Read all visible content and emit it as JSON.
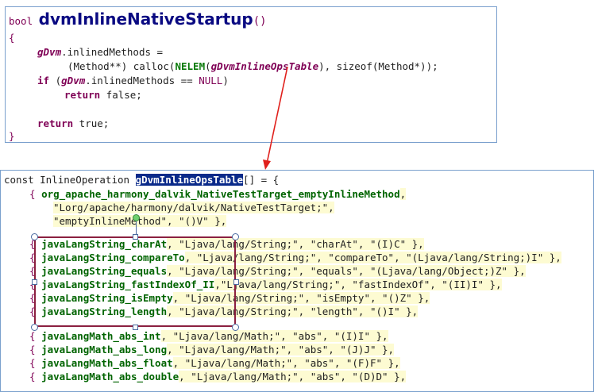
{
  "top": {
    "l1_type": "bool ",
    "l1_name": "dvmInlineNativeStartup",
    "l1_paren": "()",
    "l2": "{",
    "l3_var": "gDvm",
    "l3_rest": ".inlinedMethods =",
    "l4_a": "(Method**) calloc(",
    "l4_macro": "NELEM",
    "l4_b": "(",
    "l4_var": "gDvmInlineOpsTable",
    "l4_c": "), sizeof(Method*));",
    "l5_if": "if",
    "l5_a": " (",
    "l5_var": "gDvm",
    "l5_b": ".inlinedMethods == ",
    "l5_null": "NULL",
    "l5_c": ")",
    "l6_ret": "return",
    "l6_val": " false;",
    "l8_ret": "return",
    "l8_val": " true;",
    "l9": "}"
  },
  "bottom": {
    "decl_a": "const InlineOperation ",
    "decl_hl": "gDvmInlineOpsTable",
    "decl_b": "[] = {",
    "rows": [
      {
        "open": "{ ",
        "fn": "org_apache_harmony_dalvik_NativeTestTarget_emptyInlineMethod",
        "rest": ","
      },
      {
        "open": "",
        "fn": "",
        "rest": "\"Lorg/apache/harmony/dalvik/NativeTestTarget;\","
      },
      {
        "open": "",
        "fn": "",
        "rest": "\"emptyInlineMethod\", \"()V\" },"
      },
      {
        "open": "{ ",
        "fn": "javaLangString_charAt",
        "rest": ", \"Ljava/lang/String;\", \"charAt\", \"(I)C\" },"
      },
      {
        "open": "{ ",
        "fn": "javaLangString_compareTo",
        "rest": ", \"Ljava/lang/String;\", \"compareTo\", \"(Ljava/lang/String;)I\" },"
      },
      {
        "open": "{ ",
        "fn": "javaLangString_equals",
        "rest": ", \"Ljava/lang/String;\", \"equals\", \"(Ljava/lang/Object;)Z\" },"
      },
      {
        "open": "{ ",
        "fn": "javaLangString_fastIndexOf_II",
        "rest": ",\"Ljava/lang/String;\", \"fastIndexOf\", \"(II)I\" },"
      },
      {
        "open": "{ ",
        "fn": "javaLangString_isEmpty",
        "rest": ", \"Ljava/lang/String;\", \"isEmpty\", \"()Z\" },"
      },
      {
        "open": "{ ",
        "fn": "javaLangString_length",
        "rest": ", \"Ljava/lang/String;\", \"length\", \"()I\" },"
      },
      {
        "open": "{ ",
        "fn": "javaLangMath_abs_int",
        "rest": ", \"Ljava/lang/Math;\", \"abs\", \"(I)I\" },"
      },
      {
        "open": "{ ",
        "fn": "javaLangMath_abs_long",
        "rest": ", \"Ljava/lang/Math;\", \"abs\", \"(J)J\" },"
      },
      {
        "open": "{ ",
        "fn": "javaLangMath_abs_float",
        "rest": ", \"Ljava/lang/Math;\", \"abs\", \"(F)F\" },"
      },
      {
        "open": "{ ",
        "fn": "javaLangMath_abs_double",
        "rest": ", \"Ljava/lang/Math;\", \"abs\", \"(D)D\" },"
      }
    ]
  },
  "colors": {
    "arrow": "#e0201c",
    "border": "#7aa0cd",
    "selection": "#8b2040"
  }
}
